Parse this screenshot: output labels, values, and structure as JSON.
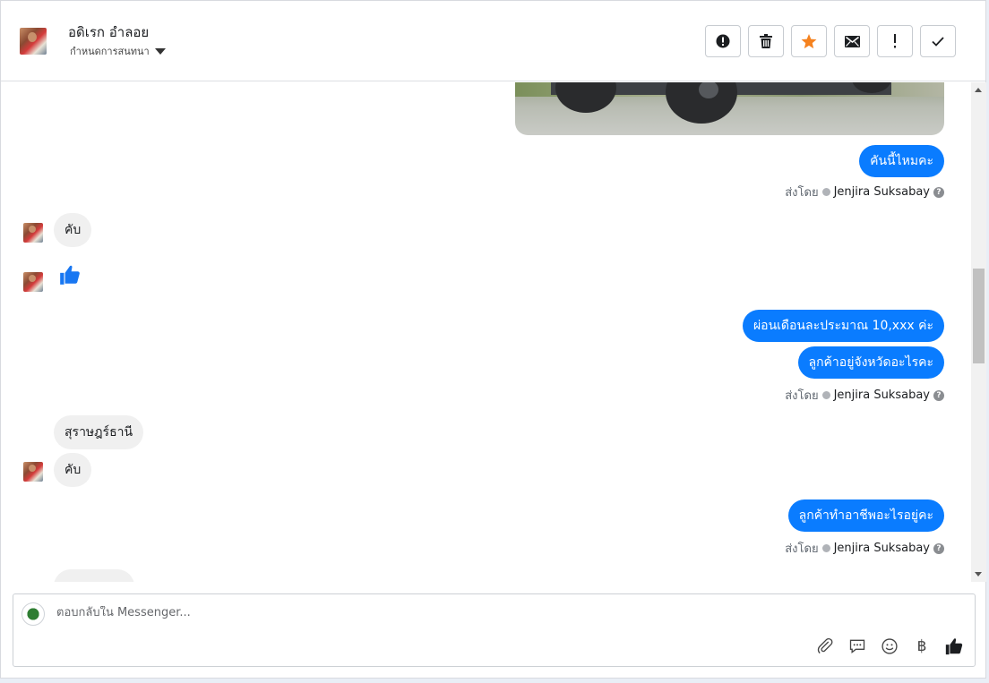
{
  "header": {
    "contact_name": "อดิเรก อำลอย",
    "subtitle": "กำหนดการสนทนา",
    "toolbar": [
      {
        "icon": "alert-circle-icon",
        "label": "!"
      },
      {
        "icon": "trash-icon"
      },
      {
        "icon": "star-icon",
        "color": "#f5821f"
      },
      {
        "icon": "envelope-icon"
      },
      {
        "icon": "exclamation-icon",
        "label": "!"
      },
      {
        "icon": "check-icon"
      }
    ]
  },
  "messages": {
    "m1": "คันนี้ไหมคะ",
    "sent_by_label": "ส่งโดย",
    "agent_name": "Jenjira Suksabay",
    "help": "?",
    "in1": "คับ",
    "in2_reaction": "thumbs-up-icon",
    "m2": "ผ่อนเดือนละประมาณ 10,xxx ค่ะ",
    "m3": "ลูกค้าอยู่จังหวัดอะไรคะ",
    "in3": "สุราษฎร์ธานี",
    "in4": "คับ",
    "m4": "ลูกค้าทำอาชีพอะไรอยู่คะ"
  },
  "composer": {
    "placeholder": "ตอบกลับใน Messenger...",
    "baht": "฿",
    "tools": [
      "paperclip-icon",
      "saved-reply-icon",
      "emoji-icon",
      "baht-icon",
      "like-icon"
    ]
  },
  "colors": {
    "outgoing_bubble": "#0a7cff",
    "incoming_bubble": "#f0f0f0",
    "like_blue": "#1877f2",
    "star_orange": "#f5821f"
  }
}
